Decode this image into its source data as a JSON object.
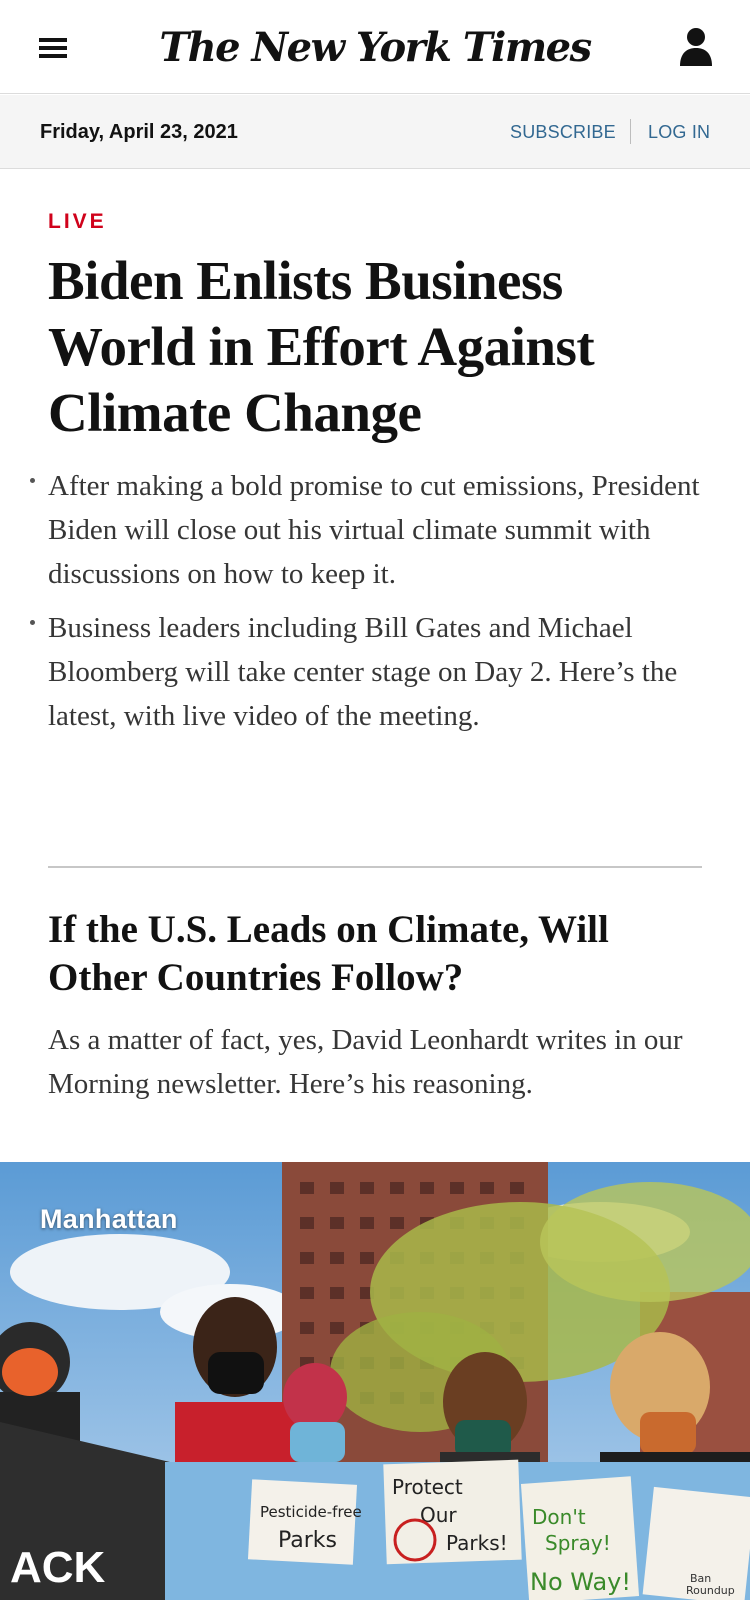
{
  "header": {
    "logo_text": "The New York Times",
    "menu_icon": "hamburger-menu-icon",
    "account_icon": "user-account-icon"
  },
  "datebar": {
    "date": "Friday, April 23, 2021",
    "subscribe_label": "SUBSCRIBE",
    "login_label": "LOG IN"
  },
  "lead_story": {
    "label": "LIVE",
    "headline": "Biden Enlists Business World in Effort Against Climate Change",
    "bullets": [
      "After making a bold promise to cut emissions, President Biden will close out his virtual climate summit with discussions on how to keep it.",
      "Business leaders including Bill Gates and Michael Bloomberg will take center stage on Day 2. Here’s the latest, with live video of the meeting."
    ]
  },
  "second_story": {
    "headline": "If the U.S. Leads on Climate, Will Other Countries Follow?",
    "summary": "As a matter of fact, yes, David Leonhardt writes in our Morning newsletter. Here’s his reasoning."
  },
  "photo": {
    "caption": "Manhattan",
    "signs": [
      "Pesticide-free Parks",
      "Protect Our Parks!",
      "Don't Spray! No Way!",
      "Ban Roundup"
    ]
  },
  "colors": {
    "live_red": "#d0021b",
    "link_blue": "#326891",
    "datebar_bg": "#f5f5f5"
  }
}
